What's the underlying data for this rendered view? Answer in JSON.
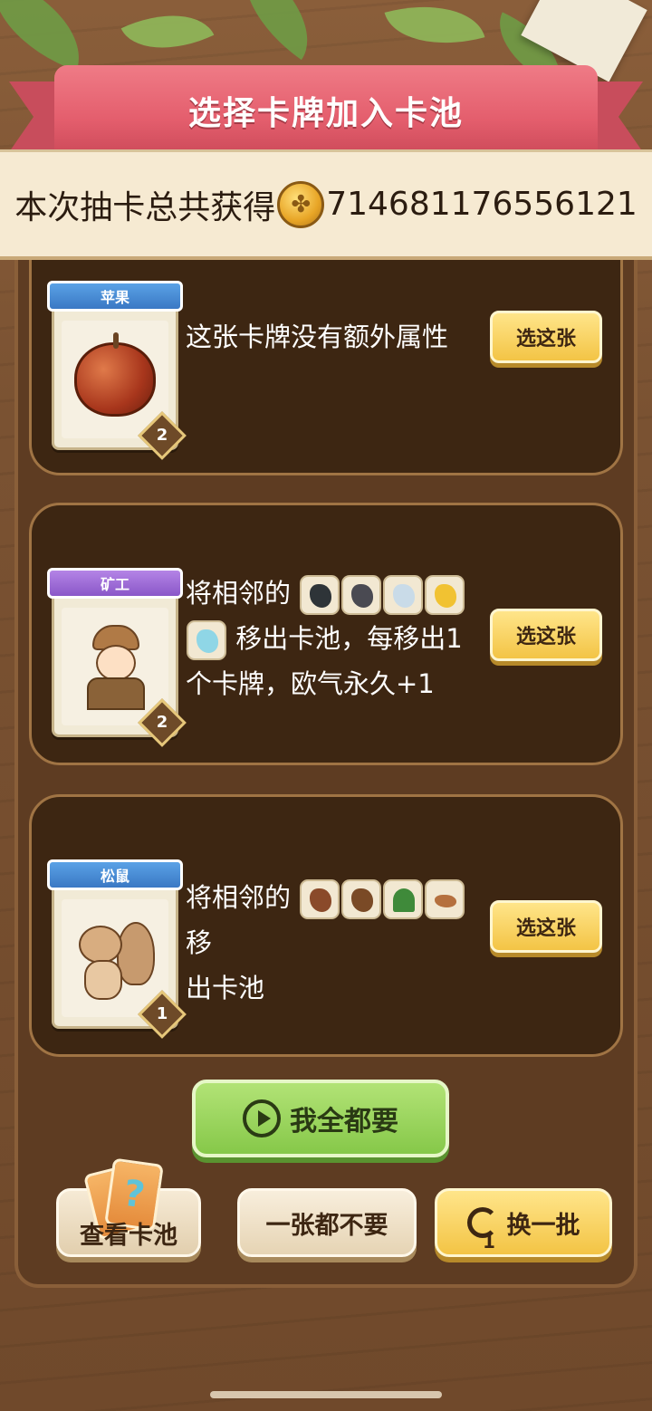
{
  "header": {
    "title": "选择卡牌加入卡池",
    "reward_text": "本次抽卡总共获得",
    "reward_amount": "714681176556121"
  },
  "cards": [
    {
      "name": "苹果",
      "level": "2",
      "banner_color": "blue",
      "icon": "apple-icon",
      "description_lines": [
        "这张卡牌没有额外属性"
      ],
      "pick_label": "选这张"
    },
    {
      "name": "矿工",
      "level": "2",
      "banner_color": "purple",
      "icon": "miner-icon",
      "description_prefix": "将相邻的",
      "description_mid": "移出卡池，每移出1",
      "description_end": "个卡牌，欧气永久+1",
      "related_icons": [
        "coal-icon",
        "stone-icon",
        "silver-ore-icon",
        "gold-ore-icon",
        "diamond-icon"
      ],
      "pick_label": "选这张"
    },
    {
      "name": "松鼠",
      "level": "1",
      "banner_color": "blue",
      "icon": "squirrel-icon",
      "description_prefix": "将相邻的",
      "description_suffix": "移",
      "description_end": "出卡池",
      "related_icons": [
        "acorn-icon",
        "pinecone-icon",
        "tree-icon",
        "nuts-icon"
      ],
      "pick_label": "选这张"
    }
  ],
  "actions": {
    "take_all": "我全都要",
    "view_pool": "查看卡池",
    "skip_all": "一张都不要",
    "refresh": "换一批",
    "refresh_count": "1"
  },
  "colors": {
    "ribbon": "#e45e6d",
    "panel": "#3d2612",
    "pick_button": "#f3c445",
    "take_all_button": "#86c849"
  }
}
